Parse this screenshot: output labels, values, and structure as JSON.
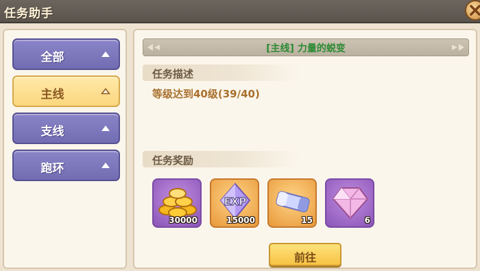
{
  "window": {
    "title": "任务助手"
  },
  "sidebar": {
    "items": [
      {
        "label": "全部",
        "active": false
      },
      {
        "label": "主线",
        "active": true
      },
      {
        "label": "支线",
        "active": false
      },
      {
        "label": "跑环",
        "active": false
      }
    ]
  },
  "quest": {
    "title": "[主线] 力量的蜕变",
    "description_header": "任务描述",
    "description": "等级达到40级(39/40)",
    "rewards_header": "任务奖励",
    "rewards": [
      {
        "icon": "gold-coins-icon",
        "count": "30000"
      },
      {
        "icon": "exp-crystal-icon",
        "count": "15000"
      },
      {
        "icon": "scroll-ticket-icon",
        "count": "15"
      },
      {
        "icon": "pink-gem-icon",
        "count": "6"
      }
    ],
    "go_button": "前往"
  },
  "colors": {
    "sidebar_button": "#7d77bd",
    "sidebar_active": "#fbdc8a",
    "quest_title": "#2c8a34",
    "description_text": "#a8702e",
    "go_button": "#f8cb4f"
  }
}
